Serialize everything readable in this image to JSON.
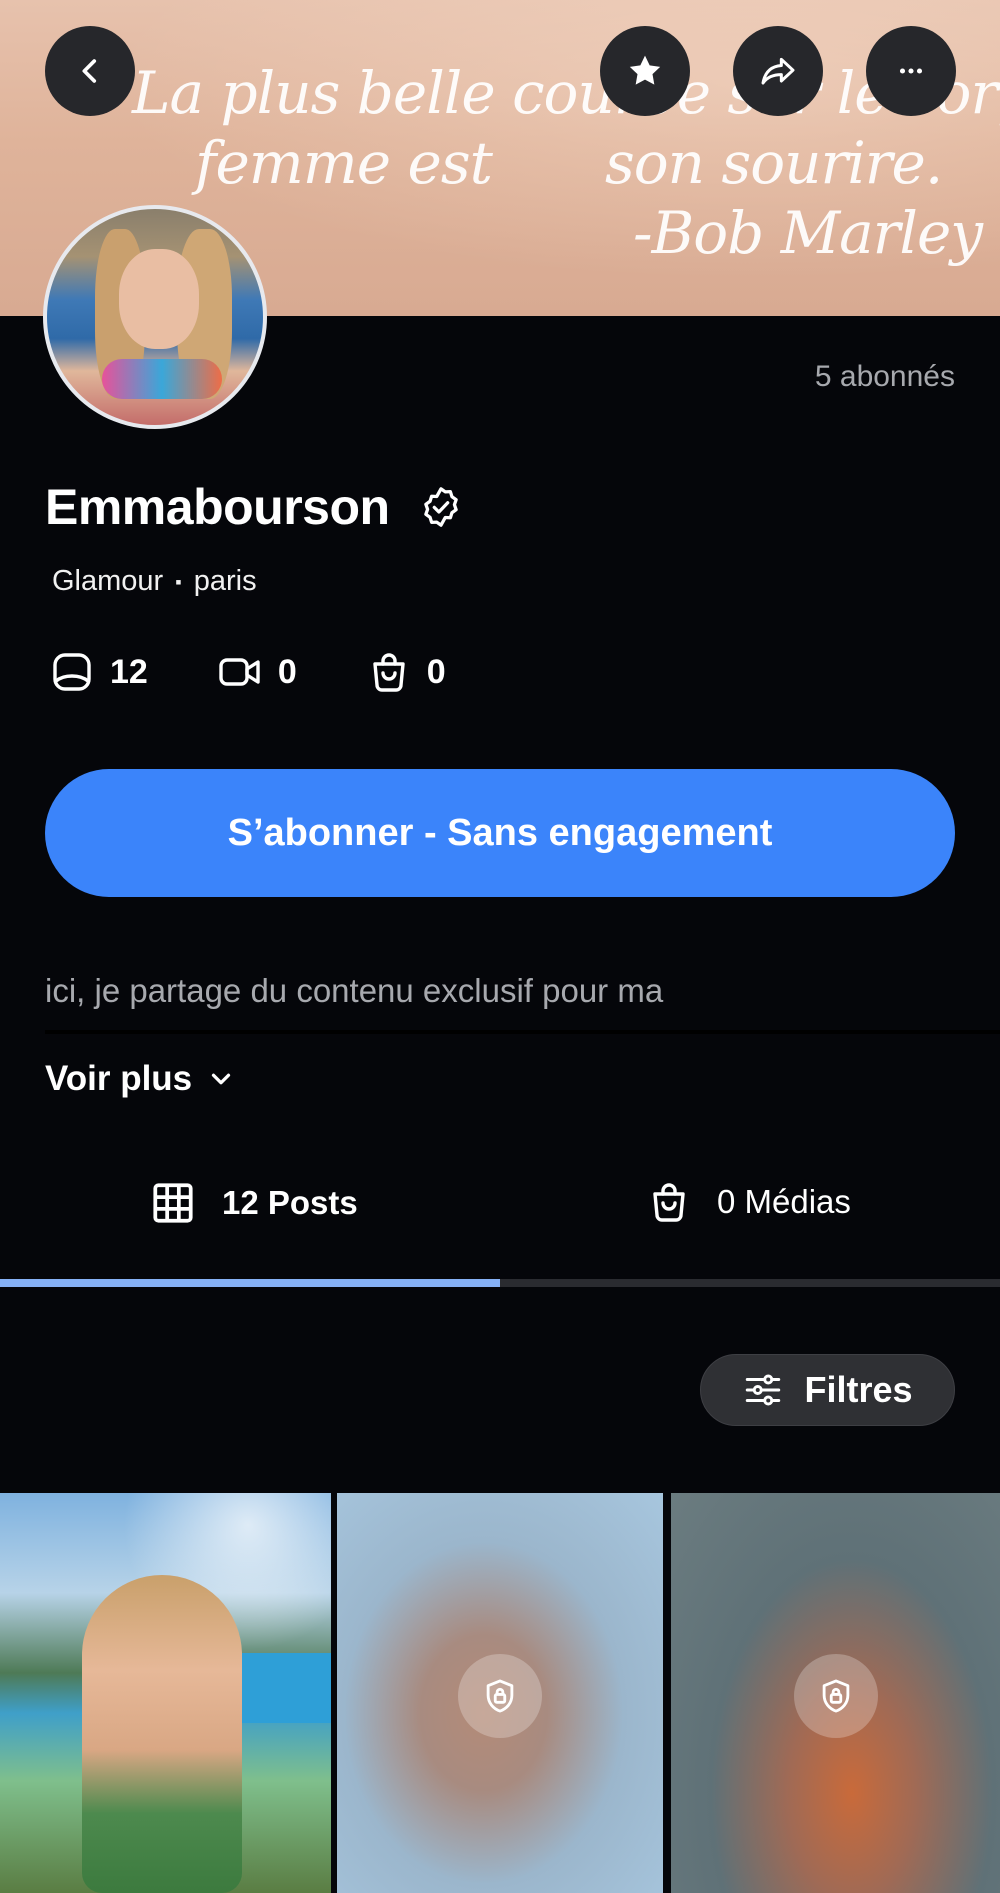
{
  "banner": {
    "quote_line1": "La plus belle courbe sur le corps d'une",
    "quote_line2a": "femme est",
    "quote_line2b": "son sourire.",
    "quote_line3": "-Bob Marley"
  },
  "header_buttons": {
    "back_icon": "chevron-left-icon",
    "favorite_icon": "star-icon",
    "share_icon": "share-icon",
    "more_icon": "more-horizontal-icon"
  },
  "profile": {
    "subscribers": "5 abonnés",
    "name": "Emmabourson",
    "verified_icon": "verified-badge-icon",
    "category": "Glamour",
    "separator": "▪",
    "location": "paris"
  },
  "stats": [
    {
      "icon": "photo-icon",
      "value": "12"
    },
    {
      "icon": "video-icon",
      "value": "0"
    },
    {
      "icon": "shopping-bag-icon",
      "value": "0"
    }
  ],
  "subscribe_label": "S’abonner - Sans engagement",
  "bio": "ici, je partage du contenu exclusif pour ma",
  "see_more": "Voir plus",
  "tabs": {
    "posts_count": "12",
    "posts_label": "Posts",
    "media_count": "0",
    "media_label": "Médias",
    "active": "posts"
  },
  "filters_label": "Filtres",
  "colors": {
    "background": "#05060a",
    "accent": "#3b84fa",
    "tab_indicator": "#86b1f6"
  }
}
